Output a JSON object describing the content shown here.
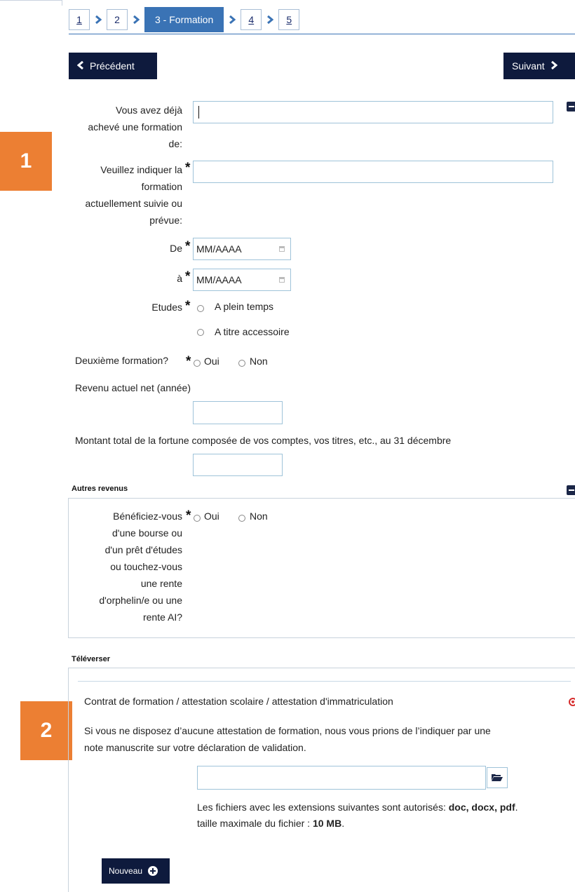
{
  "wizard": {
    "steps": [
      {
        "label": "1",
        "state": "link"
      },
      {
        "label": "2",
        "state": "plain"
      },
      {
        "label": "3 - Formation",
        "state": "active"
      },
      {
        "label": "4",
        "state": "link"
      },
      {
        "label": "5",
        "state": "link"
      }
    ],
    "prev_label": "Précédent",
    "next_label": "Suivant"
  },
  "badges": [
    "1",
    "2"
  ],
  "form": {
    "completed_training_label_lines": [
      "Vous avez déjà",
      "achevé une formation",
      "de:"
    ],
    "completed_training_value": "",
    "current_training_label_lines": [
      "Veuillez indiquer la",
      "formation",
      "actuellement suivie ou",
      "prévue:"
    ],
    "current_training_value": "",
    "from_label": "De",
    "from_placeholder": "MM/AAAA",
    "to_label": "à",
    "to_placeholder": "MM/AAAA",
    "studies_label": "Etudes",
    "studies_options": [
      "A plein temps",
      "A titre accessoire"
    ],
    "second_training_label": "Deuxième formation?",
    "yes_label": "Oui",
    "no_label": "Non",
    "income_label": "Revenu actuel net (année)",
    "income_value": "",
    "fortune_label": "Montant total de la fortune composée de vos comptes, vos titres, etc., au 31 décembre",
    "fortune_value": "",
    "required_mark": "*"
  },
  "other_income": {
    "title": "Autres revenus",
    "question_lines": [
      "Bénéficiez-vous",
      "d'une bourse ou",
      "d'un prêt d'études",
      "ou touchez-vous",
      "une rente",
      "d'orphelin/e ou une",
      "rente AI?"
    ],
    "yes_label": "Oui",
    "no_label": "Non"
  },
  "upload": {
    "title": "Téléverser",
    "document_label": "Contrat de formation / attestation scolaire / attestation d'immatriculation",
    "note_line1": "Si vous ne disposez d’aucune attestation de formation, nous vous prions de l’indiquer par une",
    "note_line2": "note manuscrite sur votre déclaration de validation.",
    "file_value": "",
    "extensions_prefix": "Les fichiers avec les extensions suivantes sont autorisés: ",
    "extensions": "doc, docx, pdf",
    "extensions_suffix": ".",
    "maxsize_prefix": "taille maximale du fichier : ",
    "maxsize": "10 MB",
    "maxsize_suffix": ".",
    "new_label": "Nouveau"
  },
  "icons": {
    "prev": "chevron-left-icon",
    "next": "chevron-right-icon",
    "collapse": "minus-icon",
    "calendar": "calendar-icon",
    "remove": "remove-circle-icon",
    "browse": "folder-open-icon",
    "add": "plus-circle-icon"
  },
  "colors": {
    "accent": "#3a73b5",
    "dark_button": "#0e1a3d",
    "badge": "#ec7f33",
    "input_border": "#9fc3d9",
    "remove": "#d62b2b"
  }
}
